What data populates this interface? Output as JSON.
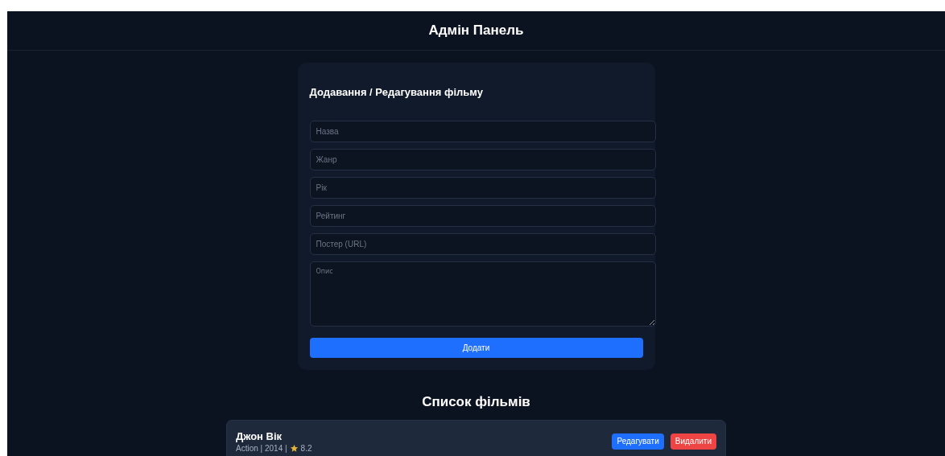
{
  "header": {
    "title": "Адмін Панель"
  },
  "form": {
    "title": "Додавання / Редагування фільму",
    "fields": [
      {
        "kind": "input",
        "placeholder": "Назва"
      },
      {
        "kind": "input",
        "placeholder": "Жанр"
      },
      {
        "kind": "input",
        "placeholder": "Рік"
      },
      {
        "kind": "input",
        "placeholder": "Рейтинг"
      },
      {
        "kind": "input",
        "placeholder": "Постер (URL)"
      },
      {
        "kind": "textarea",
        "placeholder": "Опис"
      }
    ],
    "submit": "Додати"
  },
  "list": {
    "title": "Список фільмів",
    "movies": [
      {
        "title": "Джон Вік",
        "meta": "Action | 2014 |",
        "rating": "8.2",
        "edit": "Редагувати",
        "delete": "Видалити"
      }
    ]
  }
}
